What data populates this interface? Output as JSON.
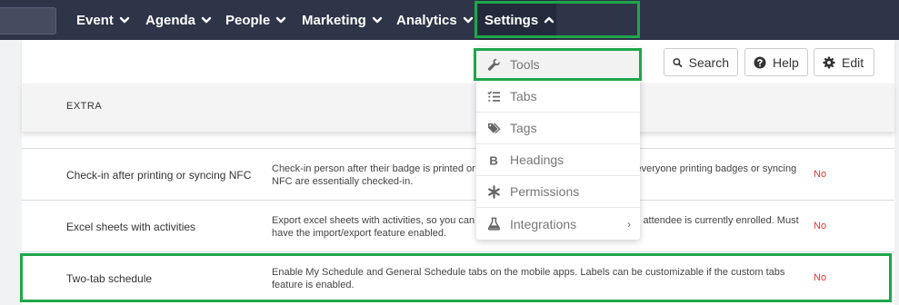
{
  "nav": {
    "items": [
      {
        "label": "Event"
      },
      {
        "label": "Agenda"
      },
      {
        "label": "People"
      },
      {
        "label": "Marketing"
      },
      {
        "label": "Analytics"
      }
    ],
    "settings_label": "Settings"
  },
  "toolbar": {
    "search_label": "Search",
    "help_label": "Help",
    "edit_label": "Edit"
  },
  "section": {
    "title": "EXTRA"
  },
  "rows": [
    {
      "name": "Check-in after printing or syncing NFC",
      "description": "Check-in person after their badge is printed or NFC synced. Useful for events that everyone printing badges or syncing NFC are essentially checked-in.",
      "value": "No"
    },
    {
      "name": "Excel sheets with activities",
      "description": "Export excel sheets with activities, so you can see in one glance all the activities an attendee is currently enrolled. Must have the import/export feature enabled.",
      "value": "No"
    },
    {
      "name": "Two-tab schedule",
      "description": "Enable My Schedule and General Schedule tabs on the mobile apps. Labels can be customizable if the custom tabs feature is enabled.",
      "value": "No"
    }
  ],
  "dropdown": {
    "items": [
      {
        "label": "Tools",
        "icon": "wrench-icon"
      },
      {
        "label": "Tabs",
        "icon": "list-check-icon"
      },
      {
        "label": "Tags",
        "icon": "tags-icon"
      },
      {
        "label": "Headings",
        "icon": "bold-icon"
      },
      {
        "label": "Permissions",
        "icon": "asterisk-icon"
      },
      {
        "label": "Integrations",
        "icon": "flask-icon",
        "has_submenu": true
      }
    ]
  },
  "colors": {
    "nav_bg": "#2e3548",
    "highlight": "#1fa64a",
    "no_value": "#e53935"
  }
}
